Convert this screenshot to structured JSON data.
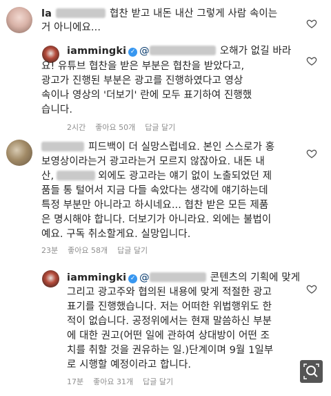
{
  "comments": [
    {
      "user": "la",
      "lines": [
        "협찬 받고 내돈 내산 그렇게 사람 속이는",
        "거 아니에요..."
      ]
    },
    {
      "user": "iammingki",
      "mention": "@",
      "lines": [
        "오해가 없길 바라",
        "요! 유튜브 협찬을 받은 부분은 협찬을 받았다고,",
        "광고가 진행된 부분은 광고를 진행하였다고 영상",
        "속이나 영상의 '더보기' 란에 모두 표기하여 진행했",
        "습니다."
      ],
      "time": "2시간",
      "likes": "좋아요 50개",
      "reply": "답글 달기"
    },
    {
      "user": "",
      "lines": [
        "피드백이 더 실망스럽네요. 본인 스스로가 홍",
        "보영상이라는거 광고라는거 모르지 않잖아요.  내돈 내",
        "산,",
        "외에도 광고라는 얘기 없이 노출되었던 제",
        "품들 통 털어서 지금 다들 속았다는 생각에 얘기하는데",
        "특정 부분만 아니라고 하시네요... 협찬 받은 모든 제품",
        "은 명시해야 합니다. 더보기가 아니라요. 외에는 불법이",
        "예요. 구독 취소할게요. 실망입니다."
      ],
      "time": "23분",
      "likes": "좋아요 58개",
      "reply": "답글 달기"
    },
    {
      "user": "iammingki",
      "mention": "@",
      "lines": [
        "콘텐츠의 기획에 맞게",
        "그리고 광고주와 협의된 내용에 맞게 적절한 광고",
        "표기를 진행했습니다. 저는 어떠한 위법행위도 한",
        "적이 없습니다. 공정위에서는 현재 말씀하신 부분",
        "에 대한 권고(어떤 일에 관하여 상대방이 어떤 조",
        "치를 취할 것을 권유하는 일.)단계이며 9월 1일부",
        "로 시행할 예정이라고 합니다."
      ],
      "time": "17분",
      "likes": "좋아요 31개",
      "reply": "답글 달기"
    }
  ],
  "icons": {
    "like": "heart-outline-icon",
    "zoom": "magnify-expand-icon",
    "verified": "verified-badge-icon"
  },
  "colors": {
    "verified": "#3897f0",
    "meta": "#8e8e8e",
    "text": "#262626"
  }
}
